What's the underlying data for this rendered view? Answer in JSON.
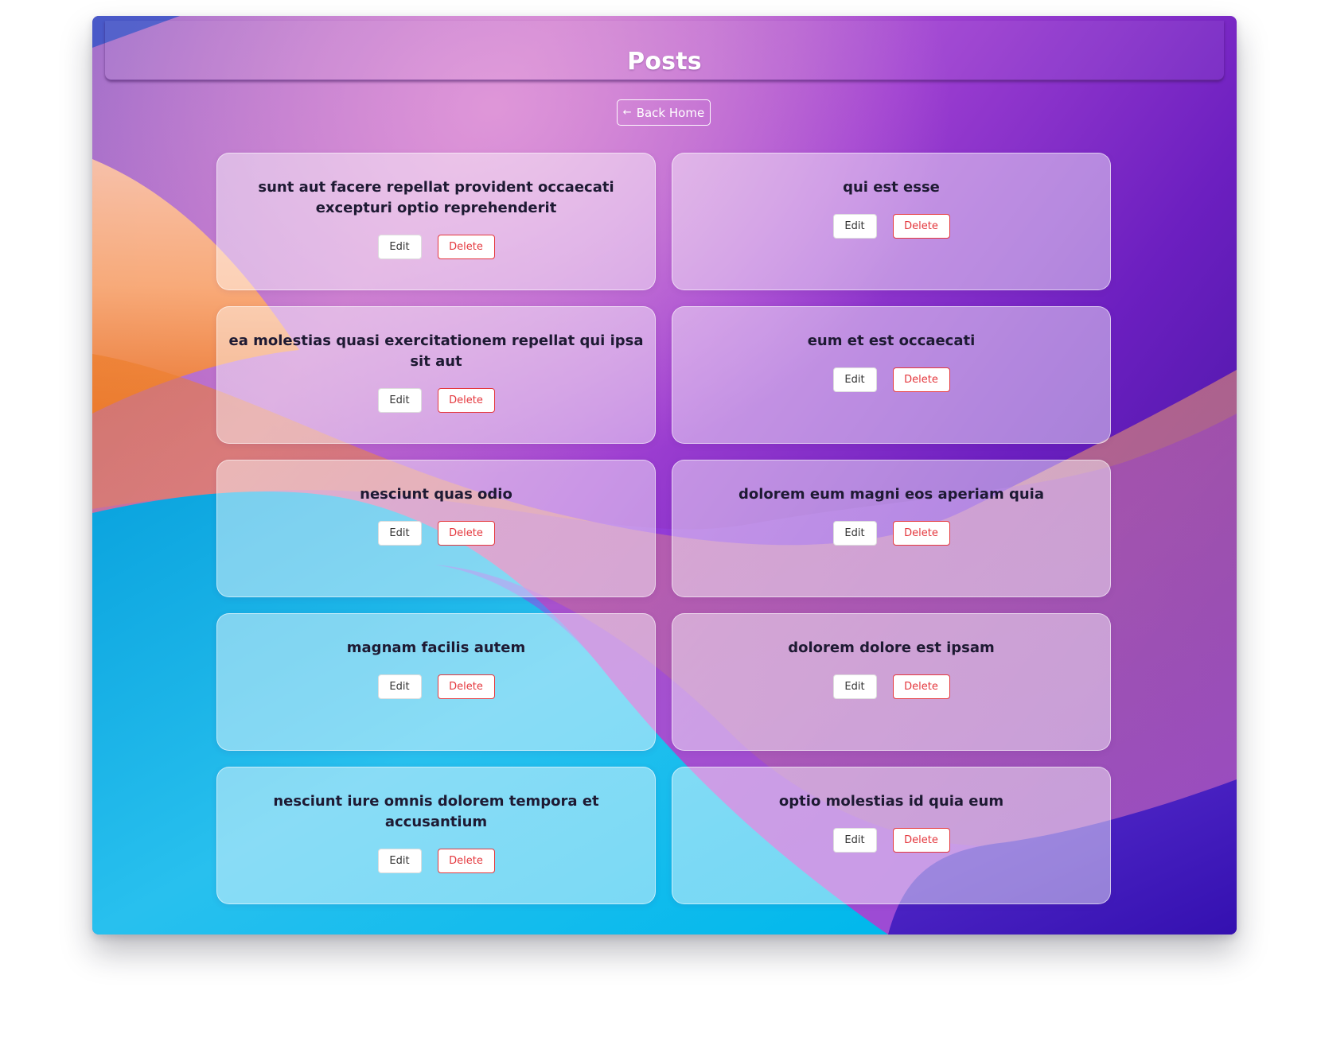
{
  "header": {
    "title": "Posts",
    "back_button_label": "Back Home",
    "back_icon": "arrow-left-icon"
  },
  "posts": [
    {
      "title": "sunt aut facere repellat provident occaecati excepturi optio reprehenderit",
      "edit_label": "Edit",
      "delete_label": "Delete"
    },
    {
      "title": "qui est esse",
      "edit_label": "Edit",
      "delete_label": "Delete"
    },
    {
      "title": "ea molestias quasi exercitationem repellat qui ipsa sit aut",
      "edit_label": "Edit",
      "delete_label": "Delete"
    },
    {
      "title": "eum et est occaecati",
      "edit_label": "Edit",
      "delete_label": "Delete"
    },
    {
      "title": "nesciunt quas odio",
      "edit_label": "Edit",
      "delete_label": "Delete"
    },
    {
      "title": "dolorem eum magni eos aperiam quia",
      "edit_label": "Edit",
      "delete_label": "Delete"
    },
    {
      "title": "magnam facilis autem",
      "edit_label": "Edit",
      "delete_label": "Delete"
    },
    {
      "title": "dolorem dolore est ipsam",
      "edit_label": "Edit",
      "delete_label": "Delete"
    },
    {
      "title": "nesciunt iure omnis dolorem tempora et accusantium",
      "edit_label": "Edit",
      "delete_label": "Delete"
    },
    {
      "title": "optio molestias id quia eum",
      "edit_label": "Edit",
      "delete_label": "Delete"
    }
  ],
  "colors": {
    "title_text": "#1e1a33",
    "delete_accent": "#e4373d",
    "wallpaper_purple": "#7d1fd0",
    "wallpaper_blue": "#00a8e8",
    "wallpaper_orange": "#f08a2a"
  }
}
